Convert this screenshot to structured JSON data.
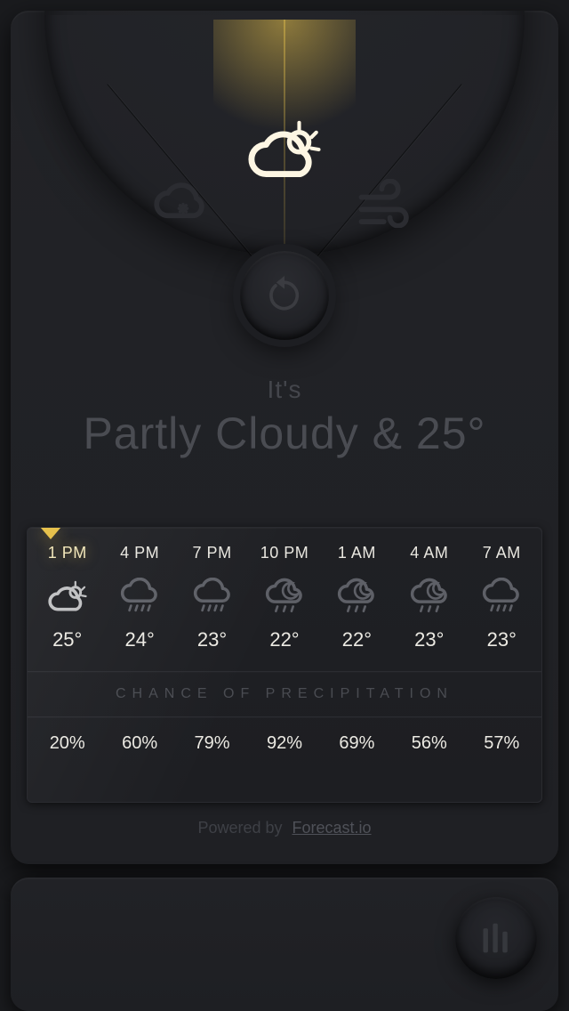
{
  "dial": {
    "left_icon": "cloud-snow-icon",
    "center_icon": "partly-cloudy-icon",
    "right_icon": "wind-icon",
    "refresh_icon": "refresh-icon"
  },
  "headline": {
    "prefix": "It's",
    "condition_line": "Partly Cloudy & 25°"
  },
  "forecast": {
    "precip_label": "CHANCE OF PRECIPITATION",
    "hours": [
      {
        "time": "1 PM",
        "icon": "partly-cloudy-icon",
        "temp": "25°",
        "precip": "20%"
      },
      {
        "time": "4 PM",
        "icon": "rain-icon",
        "temp": "24°",
        "precip": "60%"
      },
      {
        "time": "7 PM",
        "icon": "rain-icon",
        "temp": "23°",
        "precip": "79%"
      },
      {
        "time": "10 PM",
        "icon": "rain-night-icon",
        "temp": "22°",
        "precip": "92%"
      },
      {
        "time": "1 AM",
        "icon": "rain-night-icon",
        "temp": "22°",
        "precip": "69%"
      },
      {
        "time": "4 AM",
        "icon": "rain-night-icon",
        "temp": "23°",
        "precip": "56%"
      },
      {
        "time": "7 AM",
        "icon": "rain-icon",
        "temp": "23°",
        "precip": "57%"
      }
    ]
  },
  "footer": {
    "powered_by": "Powered by",
    "provider": "Forecast.io"
  },
  "colors": {
    "accent": "#e6c14c",
    "bg": "#1a1b1e",
    "panel": "#1f2024",
    "text": "#eceae3",
    "muted": "#4a4c52"
  }
}
